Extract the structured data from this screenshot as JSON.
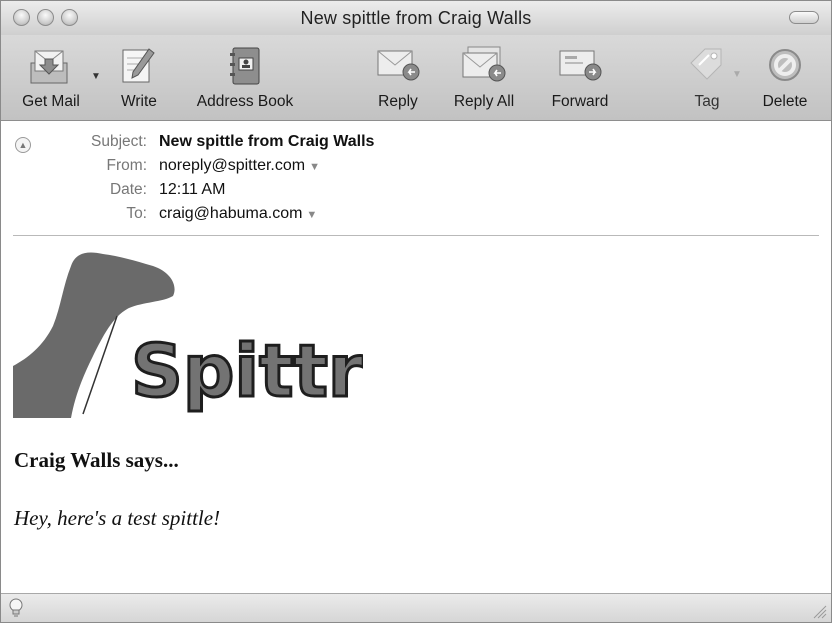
{
  "window": {
    "title": "New spittle from Craig Walls"
  },
  "toolbar": {
    "get_mail": "Get Mail",
    "write": "Write",
    "address_book": "Address Book",
    "reply": "Reply",
    "reply_all": "Reply All",
    "forward": "Forward",
    "tag": "Tag",
    "delete": "Delete"
  },
  "headers": {
    "subject_label": "Subject:",
    "subject": "New spittle from Craig Walls",
    "from_label": "From:",
    "from": "noreply@spitter.com",
    "date_label": "Date:",
    "date": "12:11 AM",
    "to_label": "To:",
    "to": "craig@habuma.com"
  },
  "body": {
    "logo_text": "Spittr",
    "says": "Craig Walls says...",
    "message": "Hey, here's a test spittle!"
  },
  "icons": [
    "get-mail-icon",
    "write-icon",
    "address-book-icon",
    "reply-icon",
    "reply-all-icon",
    "forward-icon",
    "tag-icon",
    "delete-icon",
    "collapse-icon",
    "lightbulb-icon",
    "resize-grip-icon"
  ]
}
